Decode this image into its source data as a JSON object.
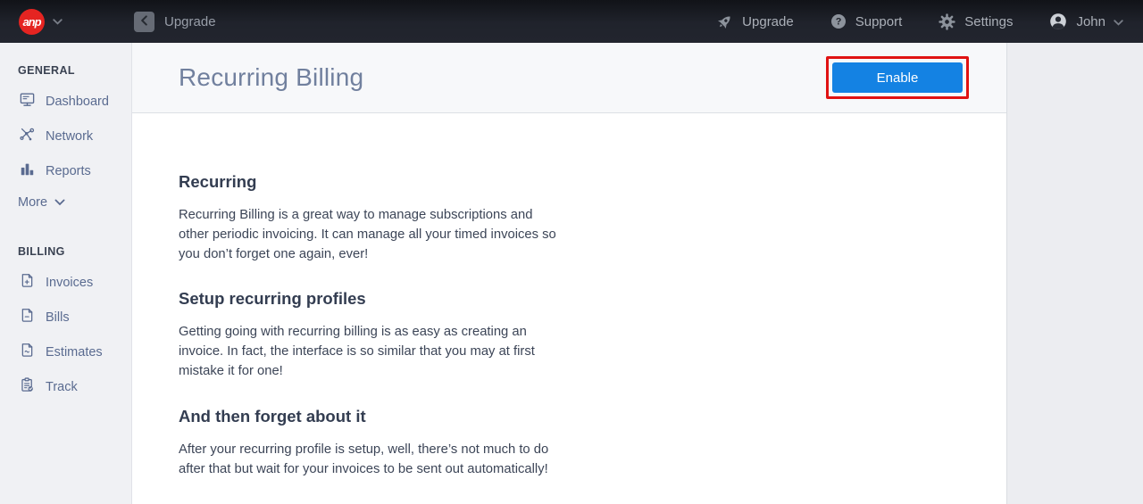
{
  "topbar": {
    "logo_text": "anp",
    "back_label": "Upgrade",
    "nav": [
      {
        "label": "Upgrade",
        "icon": "rocket-icon"
      },
      {
        "label": "Support",
        "icon": "question-icon"
      },
      {
        "label": "Settings",
        "icon": "gear-icon"
      },
      {
        "label": "John",
        "icon": "avatar-icon"
      }
    ]
  },
  "sidebar": {
    "sections": [
      {
        "title": "GENERAL",
        "items": [
          {
            "label": "Dashboard",
            "icon": "dashboard-monitor-icon"
          },
          {
            "label": "Network",
            "icon": "network-nodes-icon"
          },
          {
            "label": "Reports",
            "icon": "bar-chart-icon"
          }
        ]
      },
      {
        "title": "BILLING",
        "items": [
          {
            "label": "Invoices",
            "icon": "invoice-plus-icon"
          },
          {
            "label": "Bills",
            "icon": "bill-minus-icon"
          },
          {
            "label": "Estimates",
            "icon": "estimate-tilde-icon"
          },
          {
            "label": "Track",
            "icon": "track-clipboard-icon"
          }
        ]
      }
    ],
    "more_label": "More"
  },
  "main": {
    "title": "Recurring Billing",
    "enable_button": "Enable",
    "sections": [
      {
        "heading": "Recurring",
        "body": "Recurring Billing is a great way to manage subscriptions and other periodic invoicing. It can manage all your timed invoices so you don’t forget one again, ever!"
      },
      {
        "heading": "Setup recurring profiles",
        "body": "Getting going with recurring billing is as easy as creating an invoice. In fact, the interface is so similar that you may at first mistake it for one!"
      },
      {
        "heading": "And then forget about it",
        "body": "After your recurring profile is setup, well, there’s not much to do after that but wait for your invoices to be sent out automatically!"
      }
    ]
  },
  "colors": {
    "accent_blue": "#1482e3",
    "annotation_red": "#e01212",
    "logo_red": "#e52421",
    "topbar_bg": "#20232c",
    "sidebar_bg": "#f0f1f4"
  }
}
